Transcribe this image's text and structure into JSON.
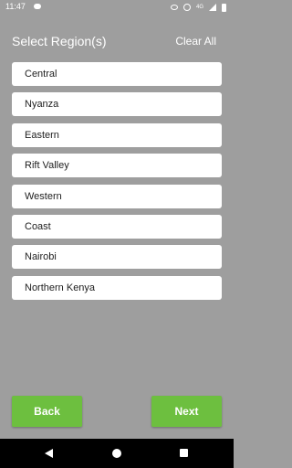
{
  "status_bar": {
    "time": "11:47",
    "network_label": "4G",
    "icons": [
      "chat-icon",
      "eye-icon",
      "hotspot-icon",
      "lte-icon",
      "signal-icon",
      "battery-icon"
    ]
  },
  "header": {
    "title": "Select Region(s)",
    "clear_all_label": "Clear All"
  },
  "regions": [
    {
      "label": "Central"
    },
    {
      "label": "Nyanza"
    },
    {
      "label": "Eastern"
    },
    {
      "label": "Rift Valley"
    },
    {
      "label": "Western"
    },
    {
      "label": "Coast"
    },
    {
      "label": "Nairobi"
    },
    {
      "label": "Northern Kenya"
    }
  ],
  "footer": {
    "back_label": "Back",
    "next_label": "Next"
  },
  "nav_bar": {
    "icons": [
      "back-icon",
      "home-icon",
      "recent-apps-icon"
    ]
  },
  "colors": {
    "background": "#9e9e9e",
    "item_background": "#ffffff",
    "button_green": "#6dbf3f",
    "nav_bar": "#000000"
  }
}
